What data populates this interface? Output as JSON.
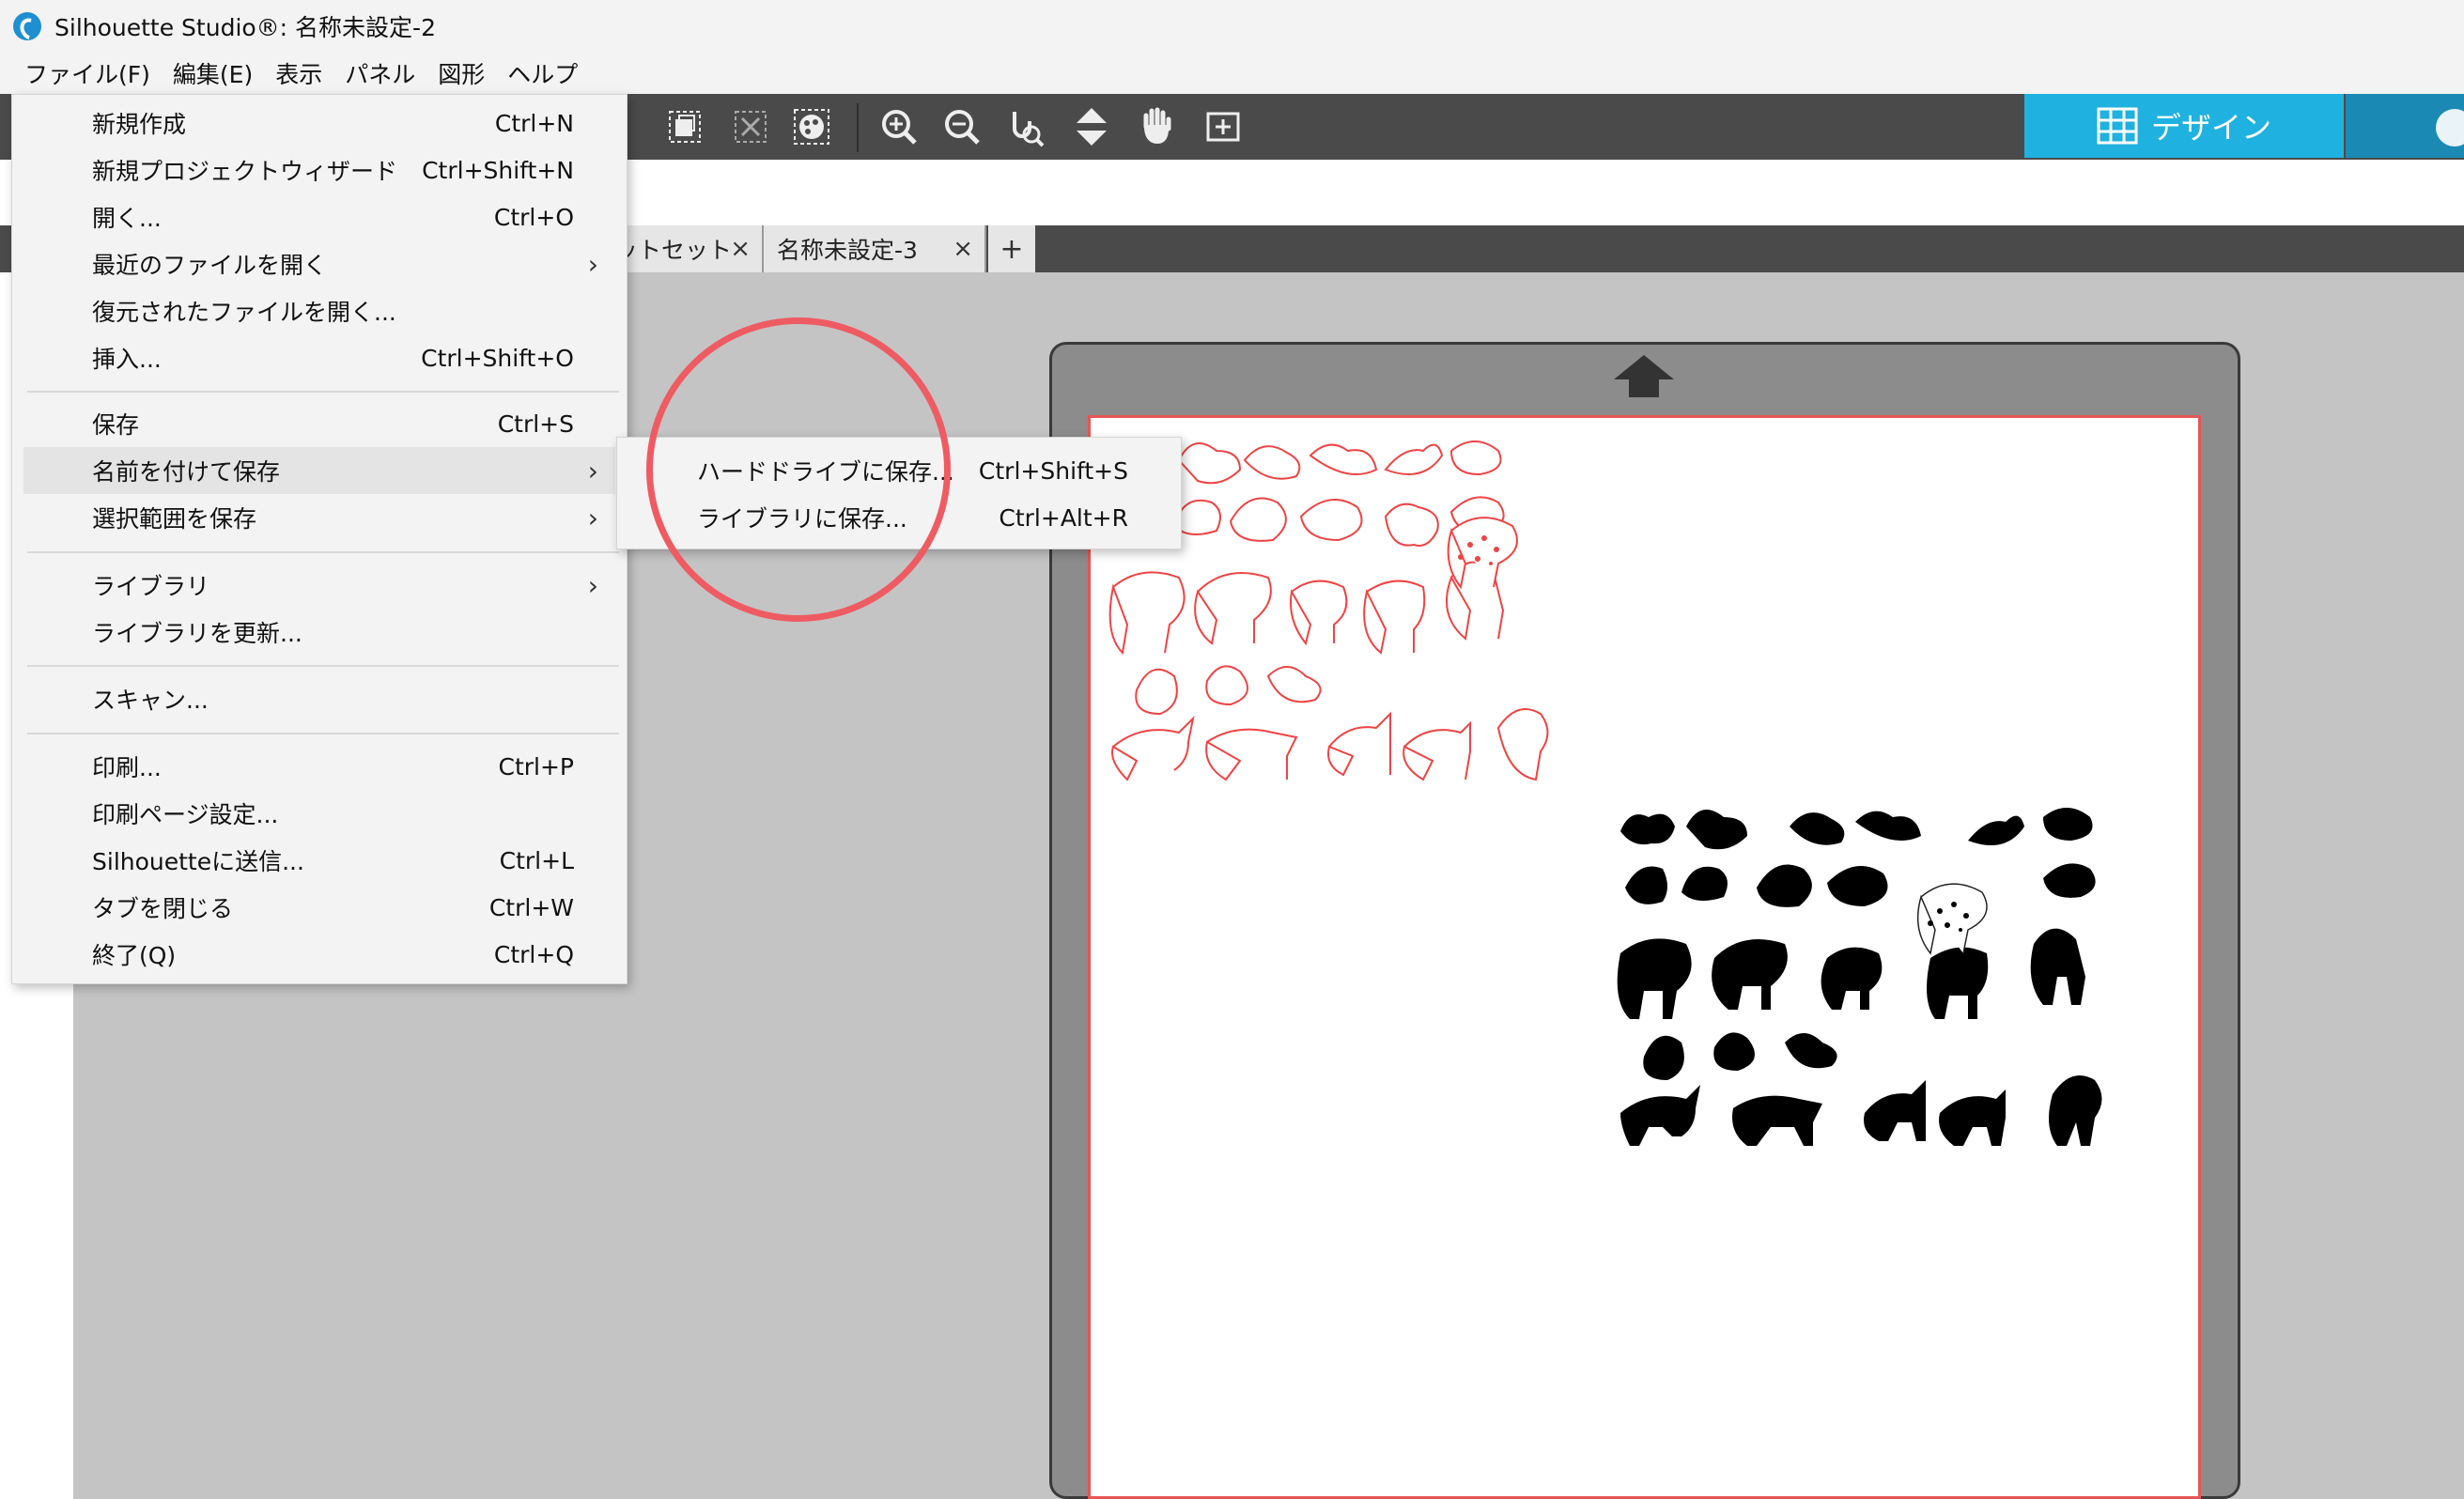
{
  "window": {
    "title": "Silhouette Studio®: 名称未設定-2"
  },
  "menubar": [
    "ファイル(F)",
    "編集(E)",
    "表示",
    "パネル",
    "図形",
    "ヘルプ"
  ],
  "toolbar": {
    "icons": [
      "group-icon",
      "ungroup-icon",
      "color-fill-icon",
      "zoom-in-icon",
      "zoom-out-icon",
      "zoom-select-icon",
      "pan-down-icon",
      "hand-pan-icon",
      "fit-page-icon"
    ],
    "design_tab_label": "デザイン",
    "accent_color": "#1fb1e0"
  },
  "doc_tabs": [
    {
      "label": "ットセット",
      "close": "×"
    },
    {
      "label": "名称未設定-3",
      "close": "×"
    }
  ],
  "add_tab_label": "+",
  "file_menu": {
    "items": [
      {
        "label": "新規作成",
        "shortcut": "Ctrl+N"
      },
      {
        "label": "新規プロジェクトウィザード",
        "shortcut": "Ctrl+Shift+N"
      },
      {
        "label": "開く...",
        "shortcut": "Ctrl+O"
      },
      {
        "label": "最近のファイルを開く",
        "submenu": true
      },
      {
        "label": "復元されたファイルを開く..."
      },
      {
        "label": "挿入...",
        "shortcut": "Ctrl+Shift+O"
      },
      {
        "label": "保存",
        "shortcut": "Ctrl+S"
      },
      {
        "label": "名前を付けて保存",
        "submenu": true,
        "highlighted": true
      },
      {
        "label": "選択範囲を保存",
        "submenu": true
      },
      {
        "label": "ライブラリ",
        "submenu": true
      },
      {
        "label": "ライブラリを更新..."
      },
      {
        "label": "スキャン..."
      },
      {
        "label": "印刷...",
        "shortcut": "Ctrl+P"
      },
      {
        "label": "印刷ページ設定..."
      },
      {
        "label": "Silhouetteに送信...",
        "shortcut": "Ctrl+L"
      },
      {
        "label": "タブを閉じる",
        "shortcut": "Ctrl+W"
      },
      {
        "label": "終了(Q)",
        "shortcut": "Ctrl+Q"
      }
    ],
    "submenu_arrow": "›"
  },
  "save_as_submenu": [
    {
      "label": "ハードドライブに保存...",
      "shortcut": "Ctrl+Shift+S"
    },
    {
      "label": "ライブラリに保存...",
      "shortcut": "Ctrl+Alt+R"
    }
  ],
  "annotation_color": "#ef5b62",
  "page_border_color": "#e85555"
}
